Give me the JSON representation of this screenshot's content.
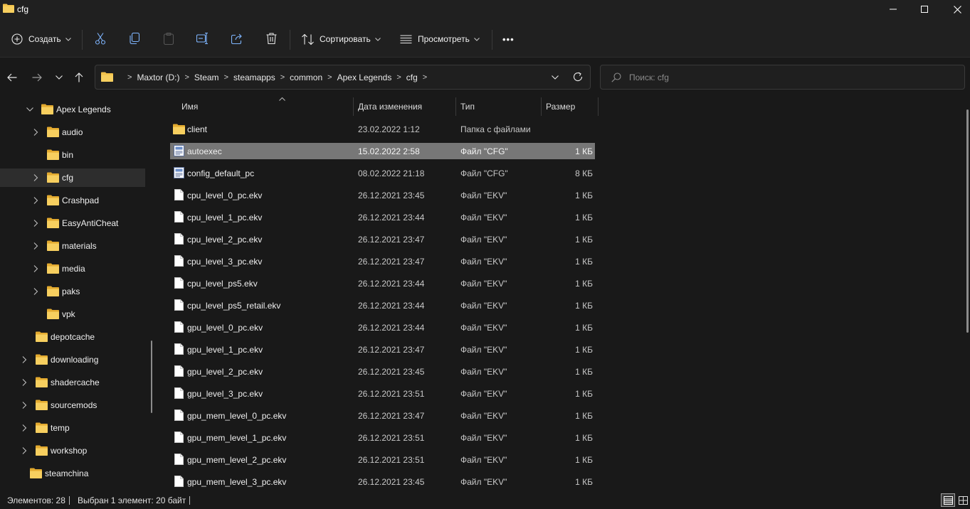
{
  "window": {
    "title": "cfg"
  },
  "toolbar": {
    "create_label": "Создать",
    "sort_label": "Сортировать",
    "view_label": "Просмотреть",
    "more_label": "•••"
  },
  "address": {
    "crumbs": [
      "Maxtor (D:)",
      "Steam",
      "steamapps",
      "common",
      "Apex Legends",
      "cfg"
    ]
  },
  "search": {
    "placeholder": "Поиск: cfg"
  },
  "nav_tree": [
    {
      "label": "Apex Legends",
      "expanded": true
    },
    {
      "label": "audio"
    },
    {
      "label": "bin"
    },
    {
      "label": "cfg",
      "selected": true
    },
    {
      "label": "Crashpad"
    },
    {
      "label": "EasyAntiCheat"
    },
    {
      "label": "materials"
    },
    {
      "label": "media"
    },
    {
      "label": "paks"
    },
    {
      "label": "vpk"
    },
    {
      "label": "depotcache"
    },
    {
      "label": "downloading"
    },
    {
      "label": "shadercache"
    },
    {
      "label": "sourcemods"
    },
    {
      "label": "temp"
    },
    {
      "label": "workshop"
    },
    {
      "label": "steamchina"
    }
  ],
  "columns": {
    "name": "Имя",
    "date": "Дата изменения",
    "type": "Тип",
    "size": "Размер"
  },
  "files": [
    {
      "name": "client",
      "date": "23.02.2022 1:12",
      "type": "Папка с файлами",
      "size": "",
      "icon": "folder-icon"
    },
    {
      "name": "autoexec",
      "date": "15.02.2022 2:58",
      "type": "Файл \"CFG\"",
      "size": "1 КБ",
      "icon": "config-file-icon",
      "selected": true
    },
    {
      "name": "config_default_pc",
      "date": "08.02.2022 21:18",
      "type": "Файл \"CFG\"",
      "size": "8 КБ",
      "icon": "config-file-icon"
    },
    {
      "name": "cpu_level_0_pc.ekv",
      "date": "26.12.2021 23:45",
      "type": "Файл \"EKV\"",
      "size": "1 КБ",
      "icon": "file-icon"
    },
    {
      "name": "cpu_level_1_pc.ekv",
      "date": "26.12.2021 23:44",
      "type": "Файл \"EKV\"",
      "size": "1 КБ",
      "icon": "file-icon"
    },
    {
      "name": "cpu_level_2_pc.ekv",
      "date": "26.12.2021 23:47",
      "type": "Файл \"EKV\"",
      "size": "1 КБ",
      "icon": "file-icon"
    },
    {
      "name": "cpu_level_3_pc.ekv",
      "date": "26.12.2021 23:47",
      "type": "Файл \"EKV\"",
      "size": "1 КБ",
      "icon": "file-icon"
    },
    {
      "name": "cpu_level_ps5.ekv",
      "date": "26.12.2021 23:44",
      "type": "Файл \"EKV\"",
      "size": "1 КБ",
      "icon": "file-icon"
    },
    {
      "name": "cpu_level_ps5_retail.ekv",
      "date": "26.12.2021 23:44",
      "type": "Файл \"EKV\"",
      "size": "1 КБ",
      "icon": "file-icon"
    },
    {
      "name": "gpu_level_0_pc.ekv",
      "date": "26.12.2021 23:44",
      "type": "Файл \"EKV\"",
      "size": "1 КБ",
      "icon": "file-icon"
    },
    {
      "name": "gpu_level_1_pc.ekv",
      "date": "26.12.2021 23:47",
      "type": "Файл \"EKV\"",
      "size": "1 КБ",
      "icon": "file-icon"
    },
    {
      "name": "gpu_level_2_pc.ekv",
      "date": "26.12.2021 23:45",
      "type": "Файл \"EKV\"",
      "size": "1 КБ",
      "icon": "file-icon"
    },
    {
      "name": "gpu_level_3_pc.ekv",
      "date": "26.12.2021 23:51",
      "type": "Файл \"EKV\"",
      "size": "1 КБ",
      "icon": "file-icon"
    },
    {
      "name": "gpu_mem_level_0_pc.ekv",
      "date": "26.12.2021 23:47",
      "type": "Файл \"EKV\"",
      "size": "1 КБ",
      "icon": "file-icon"
    },
    {
      "name": "gpu_mem_level_1_pc.ekv",
      "date": "26.12.2021 23:51",
      "type": "Файл \"EKV\"",
      "size": "1 КБ",
      "icon": "file-icon"
    },
    {
      "name": "gpu_mem_level_2_pc.ekv",
      "date": "26.12.2021 23:51",
      "type": "Файл \"EKV\"",
      "size": "1 КБ",
      "icon": "file-icon"
    },
    {
      "name": "gpu_mem_level_3_pc.ekv",
      "date": "26.12.2021 23:45",
      "type": "Файл \"EKV\"",
      "size": "1 КБ",
      "icon": "file-icon"
    }
  ],
  "status": {
    "items_count": "Элементов: 28",
    "selection": "Выбран 1 элемент: 20 байт"
  },
  "colors": {
    "folder": "#f3c24b",
    "selection": "#777777",
    "background": "#191919"
  }
}
